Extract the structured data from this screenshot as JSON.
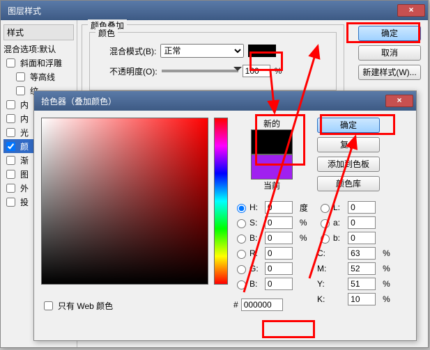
{
  "w1": {
    "title": "图层样式",
    "side": {
      "hdr": "样式",
      "opt": "混合选项:默认",
      "items": [
        "斜面和浮雕",
        "等高线",
        "纹",
        "内",
        "内",
        "光",
        "颜",
        "渐",
        "图",
        "外",
        "投"
      ]
    },
    "group1": "颜色叠加",
    "group2": "颜色",
    "blendLabel": "混合模式(B):",
    "blendVal": "正常",
    "opLabel": "不透明度(O):",
    "opVal": "100",
    "opUnit": "%",
    "btns": {
      "ok": "确定",
      "cancel": "取消",
      "new": "新建样式(W)..."
    }
  },
  "w2": {
    "title": "拾色器（叠加颜色）",
    "newL": "新的",
    "curL": "当前",
    "newColor": "#000000",
    "curColor": "#a020f0",
    "webOnly": "只有 Web 颜色",
    "btns": {
      "ok": "确定",
      "reset": "复位",
      "add": "添加到色板",
      "lib": "颜色库"
    },
    "H": {
      "l": "H:",
      "v": "0",
      "u": "度"
    },
    "S": {
      "l": "S:",
      "v": "0",
      "u": "%"
    },
    "Bv": {
      "l": "B:",
      "v": "0",
      "u": "%"
    },
    "R": {
      "l": "R:",
      "v": "0"
    },
    "G": {
      "l": "G:",
      "v": "0"
    },
    "B2": {
      "l": "B:",
      "v": "0"
    },
    "L": {
      "l": "L:",
      "v": "0"
    },
    "a": {
      "l": "a:",
      "v": "0"
    },
    "b": {
      "l": "b:",
      "v": "0"
    },
    "C": {
      "l": "C:",
      "v": "63",
      "u": "%"
    },
    "M": {
      "l": "M:",
      "v": "52",
      "u": "%"
    },
    "Y": {
      "l": "Y:",
      "v": "51",
      "u": "%"
    },
    "K": {
      "l": "K:",
      "v": "10",
      "u": "%"
    },
    "hex": {
      "l": "#",
      "v": "000000"
    }
  }
}
